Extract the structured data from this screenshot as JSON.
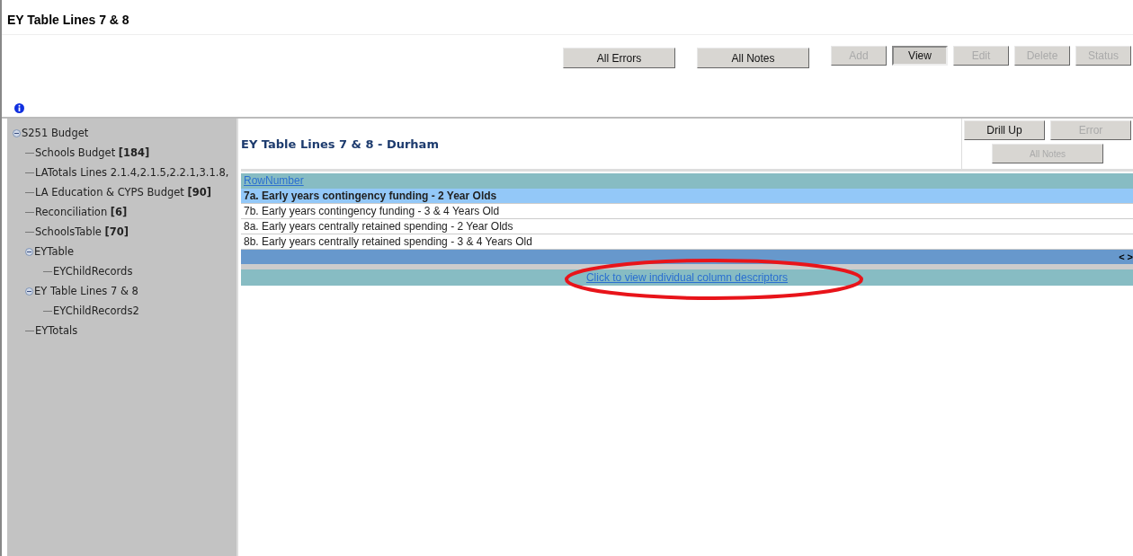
{
  "page_title": "EY Table Lines 7 & 8",
  "toolbar": [
    {
      "label": "All Errors",
      "kind": "wide",
      "disabled": false,
      "selected": false
    },
    {
      "label": "All Notes",
      "kind": "wide",
      "disabled": false,
      "selected": false
    },
    {
      "label": "Add",
      "kind": "small",
      "disabled": true,
      "selected": false
    },
    {
      "label": "View",
      "kind": "small",
      "disabled": false,
      "selected": true
    },
    {
      "label": "Edit",
      "kind": "small",
      "disabled": true,
      "selected": false
    },
    {
      "label": "Delete",
      "kind": "small",
      "disabled": true,
      "selected": false
    },
    {
      "label": "Status",
      "kind": "small",
      "disabled": true,
      "selected": false
    }
  ],
  "tree": [
    {
      "label": "S251 Budget",
      "expanded": true,
      "children": [
        {
          "label": "Schools Budget **[184]**"
        },
        {
          "label": "LATotals Lines 2.1.4,2.1.5,2.2.1,3.1.8,"
        },
        {
          "label": "LA Education & CYPS Budget **[90]**"
        },
        {
          "label": "Reconciliation **[6]**"
        },
        {
          "label": "SchoolsTable **[70]**"
        },
        {
          "label": "EYTable",
          "expanded": true,
          "children": [
            {
              "label": "EYChildRecords"
            }
          ]
        },
        {
          "label": "EY Table Lines 7 & 8",
          "expanded": true,
          "children": [
            {
              "label": "EYChildRecords2"
            }
          ]
        },
        {
          "label": "EYTotals"
        }
      ]
    }
  ],
  "panel": {
    "title": "EY Table Lines 7 & 8 - Durham",
    "buttons": [
      {
        "label": "Drill Up",
        "disabled": false
      },
      {
        "label": "Error",
        "disabled": true
      },
      {
        "label": "All Notes",
        "disabled": true
      }
    ]
  },
  "table": {
    "header": "RowNumber",
    "rows": [
      {
        "text": "7a. Early years contingency funding - 2 Year Olds",
        "selected": true
      },
      {
        "text": "7b. Early years contingency funding - 3 & 4 Years Old",
        "selected": false
      },
      {
        "text": "8a. Early years centrally retained spending - 2 Year Olds",
        "selected": false
      },
      {
        "text": "8b. Early years centrally retained spending - 3 & 4 Years Old",
        "selected": false
      }
    ],
    "pager": [
      "<",
      ">"
    ]
  },
  "descriptor_link": "Click to view individual column descriptors"
}
